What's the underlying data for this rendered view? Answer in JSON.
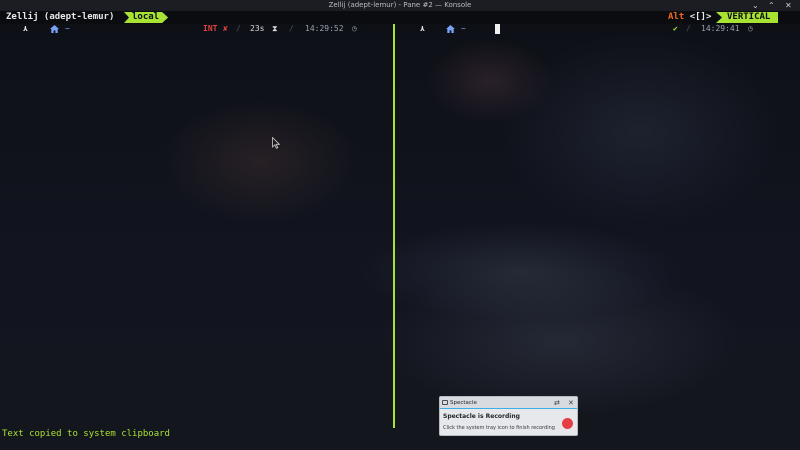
{
  "window": {
    "title": "Zellij (adept-lemur) - Pane #2 — Konsole",
    "minimize_glyph": "⌄",
    "maximize_glyph": "⌃",
    "close_glyph": "✕"
  },
  "zellij": {
    "session_label": "Zellij (adept-lemur)",
    "tab_label": "local",
    "modifier_key": "Alt",
    "modifier_hint": "<[]>",
    "mode": "VERTICAL"
  },
  "left_pane": {
    "os_glyph": "⋏",
    "dir": "~",
    "status_text": "INT",
    "status_glyph": "✘",
    "duration": "23s",
    "duration_glyph": "⧗",
    "separator": "/",
    "time": "14:29:52",
    "clock_glyph": "◷"
  },
  "right_pane": {
    "os_glyph": "⋏",
    "dir": "~",
    "ok_glyph": "✔",
    "separator": "/",
    "time": "14:29:41",
    "clock_glyph": "◷"
  },
  "status_message": "Text copied to system clipboard",
  "notification": {
    "app_name": "Spectacle",
    "title": "Spectacle is Recording",
    "body": "Click the system tray icon to finish recording",
    "configure_glyph": "⇄",
    "close_glyph": "✕"
  },
  "colors": {
    "accent": "#a8e232",
    "error": "#e0443d",
    "modifier": "#f2681f",
    "ok": "#a8e232",
    "record": "#e53f44"
  }
}
